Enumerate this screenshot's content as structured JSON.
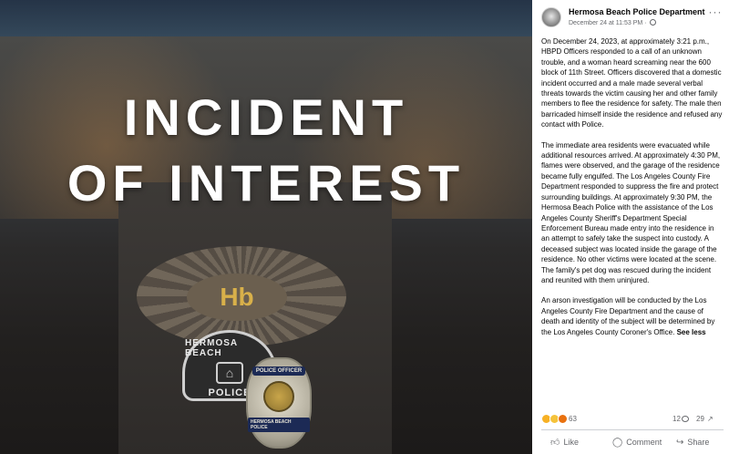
{
  "image": {
    "headline_line1": "INCIDENT",
    "headline_line2": "OF INTEREST",
    "plaza_logo": "Hb",
    "patch_title": "HERMOSA BEACH",
    "patch_label": "POLICE",
    "star_banner": "POLICE OFFICER",
    "star_city": "HERMOSA BEACH POLICE"
  },
  "post": {
    "page_name": "Hermosa Beach Police Department",
    "date": "December 24 at 11:53 PM",
    "more_glyph": "···",
    "paragraphs": [
      "On December 24, 2023, at approximately 3:21 p.m., HBPD Officers responded to a call of an unknown trouble, and a woman heard screaming near the 600 block of 11th Street. Officers discovered that a domestic incident occurred and a male made several verbal threats towards the victim causing her and other family members to flee the residence for safety. The male then barricaded himself inside the residence and refused any contact with Police.",
      "The immediate area residents were evacuated while additional resources arrived. At approximately 4:30 PM, flames were observed, and the garage of the residence became fully engulfed. The Los Angeles County Fire Department responded to suppress the fire and protect surrounding buildings. At approximately 9:30 PM, the Hermosa Beach Police with the assistance of the Los Angeles County Sheriff's Department Special Enforcement Bureau made entry into the residence in an attempt to safely take the suspect into custody. A deceased subject was located inside the garage of the residence. No other victims were located at the scene. The family's pet dog was rescued during the incident and reunited with them uninjured.",
      "An arson investigation will be conducted by the Los Angeles County Fire Department and the cause of death and identity of the subject will be determined by the Los Angeles County Coroner's Office."
    ],
    "see_less": "See less",
    "reaction_count": "63",
    "comments_count": "12",
    "shares_count": "29",
    "actions": {
      "like": "Like",
      "comment": "Comment",
      "share": "Share"
    }
  },
  "icons": {
    "avatar": "page-avatar",
    "globe": "globe-icon",
    "like": "thumbs-up-icon",
    "comment": "comment-bubble-icon",
    "share": "share-arrow-icon"
  },
  "colors": {
    "text_primary": "#050505",
    "text_secondary": "#65676b",
    "divider": "#ced0d4",
    "headline": "#ffffff"
  }
}
